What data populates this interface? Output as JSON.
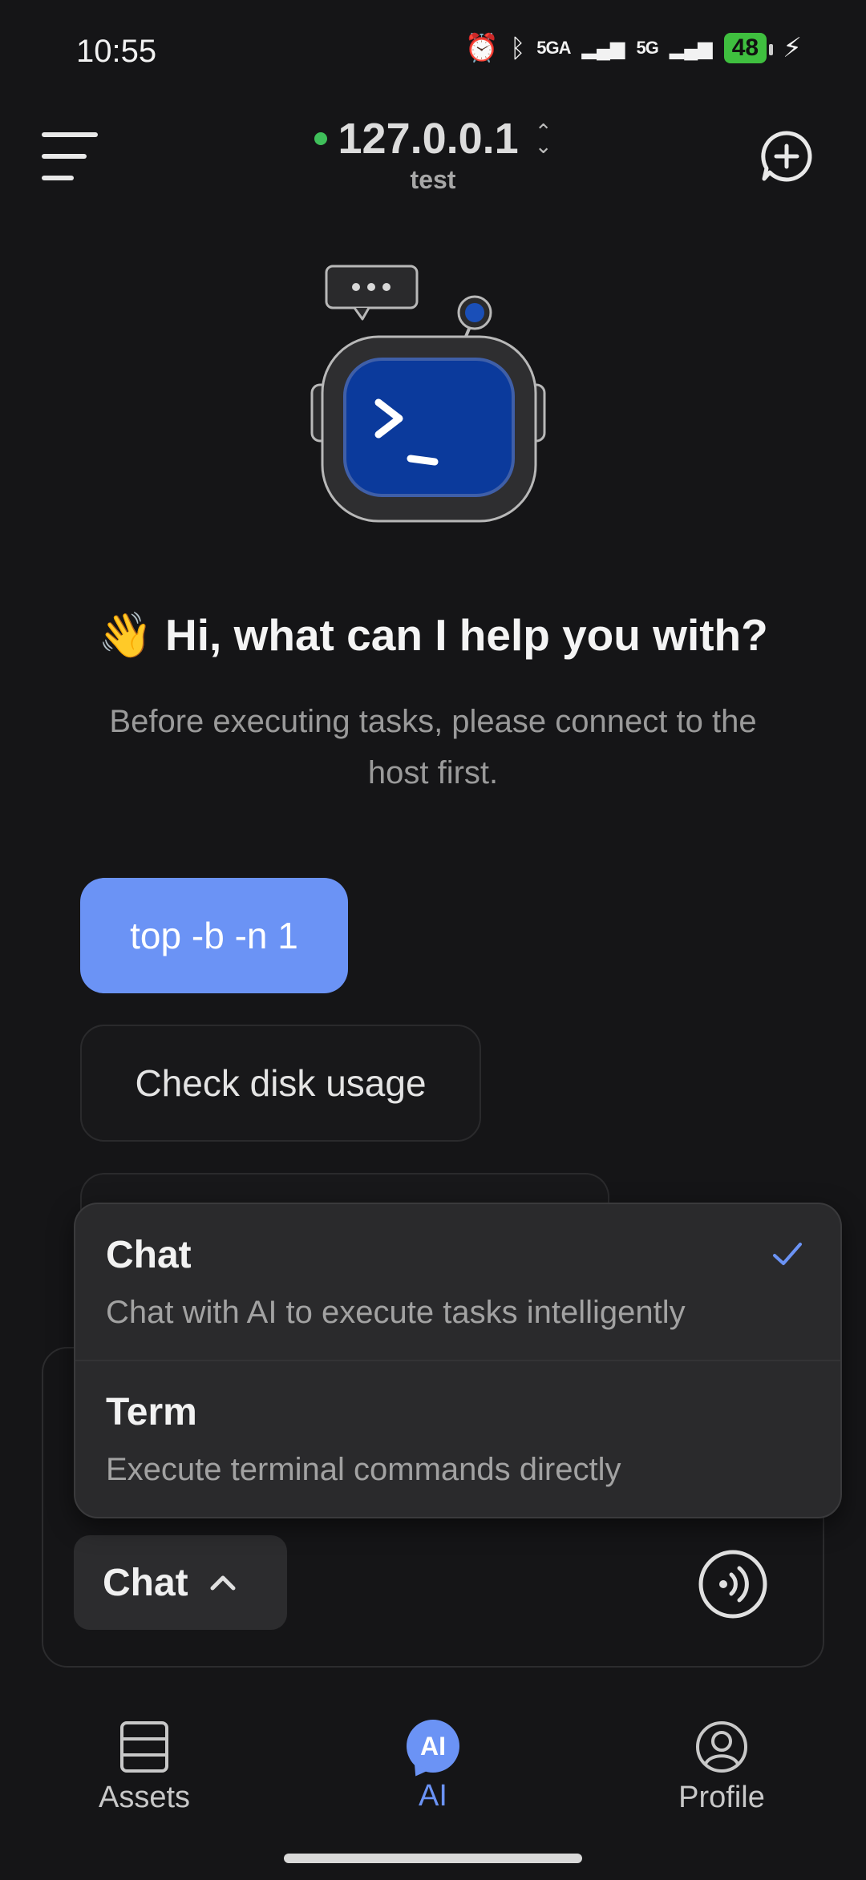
{
  "status_bar": {
    "time": "10:55",
    "signal_1": "5GA",
    "signal_2": "5G",
    "battery": "48"
  },
  "header": {
    "host_ip": "127.0.0.1",
    "host_name": "test",
    "status_color": "#3fbf5a"
  },
  "hero": {
    "wave_emoji": "👋",
    "greeting": "Hi, what can I help you with?",
    "subtitle": "Before executing tasks, please connect to the host first."
  },
  "suggestions": [
    {
      "label": "top -b -n 1"
    },
    {
      "label": "Check disk usage"
    }
  ],
  "mode_menu": {
    "options": [
      {
        "title": "Chat",
        "description": "Chat with AI to execute tasks intelligently",
        "selected": true
      },
      {
        "title": "Term",
        "description": "Execute terminal commands directly",
        "selected": false
      }
    ]
  },
  "composer": {
    "mode_label": "Chat"
  },
  "bottom_nav": {
    "items": [
      {
        "label": "Assets",
        "icon": "server-stack-icon",
        "active": false
      },
      {
        "label": "AI",
        "icon": "ai-chat-icon",
        "active": true
      },
      {
        "label": "Profile",
        "icon": "user-circle-icon",
        "active": false
      }
    ]
  },
  "colors": {
    "accent": "#6b93f5",
    "background": "#151517"
  }
}
